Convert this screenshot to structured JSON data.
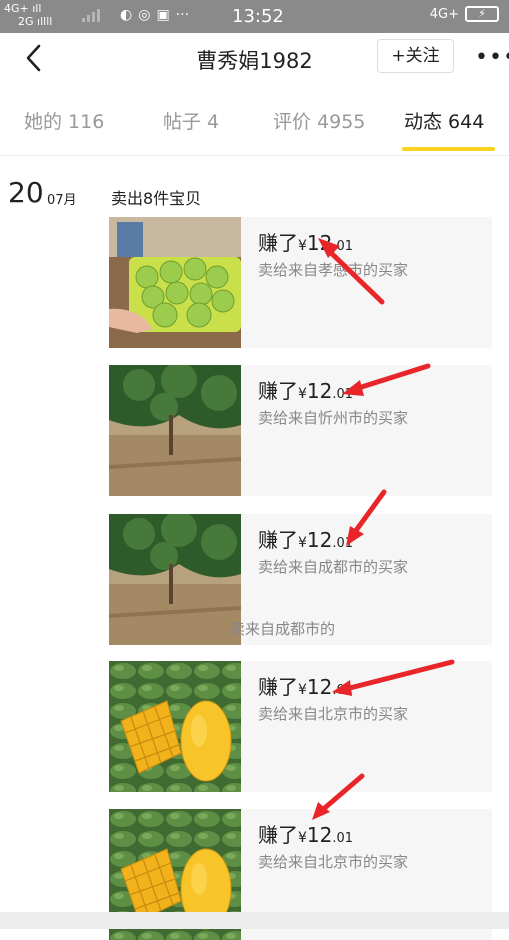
{
  "status_bar": {
    "net_top": "4G+ ıll",
    "net_bottom": "2G ıllll",
    "time": "13:52",
    "net_right": "4G+",
    "battery": "⚡"
  },
  "nav": {
    "back_icon": "chevron-left-icon",
    "title": "曹秀娟1982",
    "follow_label": "+关注",
    "more_label": "•••"
  },
  "tabs": [
    {
      "label": "她的 116",
      "active": false
    },
    {
      "label": "帖子 4",
      "active": false
    },
    {
      "label": "评价 4955",
      "active": false
    },
    {
      "label": "动态 644",
      "active": true
    }
  ],
  "accent_color": "#ffd21f",
  "feed": {
    "date_day": "20",
    "date_month": "07月",
    "title": "卖出8件宝贝",
    "items": [
      {
        "earned_prefix": "赚了",
        "currency": "¥",
        "amount": "12",
        "cents": ".01",
        "buyer": "卖给来自孝感市的买家",
        "image": "green-apples-basket"
      },
      {
        "earned_prefix": "赚了",
        "currency": "¥",
        "amount": "12",
        "cents": ".01",
        "buyer": "卖给来自忻州市的买家",
        "image": "mango-orchard"
      },
      {
        "earned_prefix": "赚了",
        "currency": "¥",
        "amount": "12",
        "cents": ".01",
        "buyer": "卖给来自成都市的买家",
        "image": "mango-orchard"
      },
      {
        "earned_prefix": "赚了",
        "currency": "¥",
        "amount": "12",
        "cents": ".01",
        "buyer": "卖给来自北京市的买家",
        "image": "cut-mangoes"
      },
      {
        "earned_prefix": "赚了",
        "currency": "¥",
        "amount": "12",
        "cents": ".01",
        "buyer": "卖给来自北京市的买家",
        "image": "cut-mangoes"
      }
    ],
    "overlay_text": "卖来自成都市的"
  }
}
